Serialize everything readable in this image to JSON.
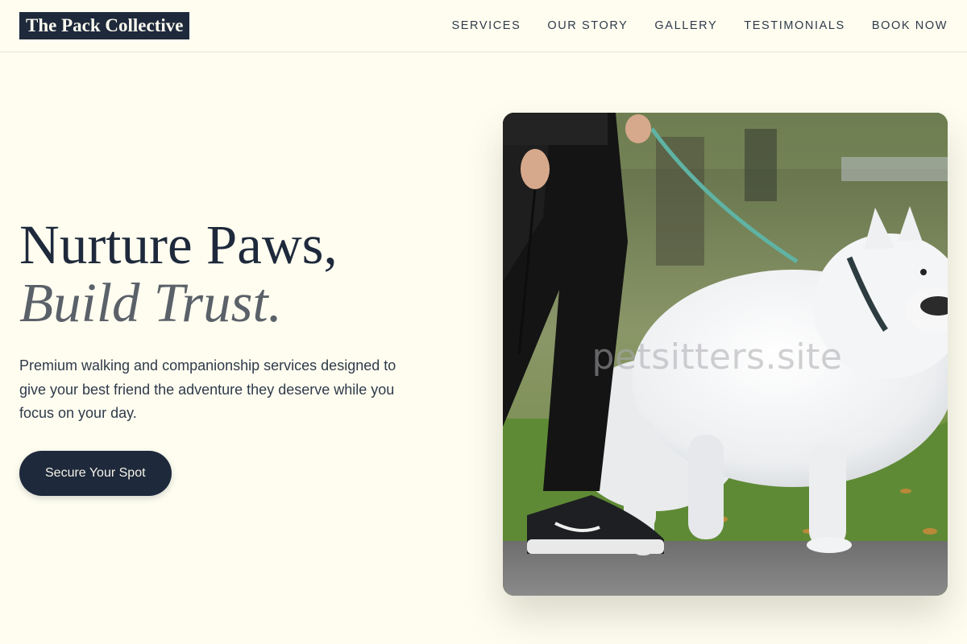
{
  "brand": {
    "name": "The Pack Collective"
  },
  "nav": {
    "items": [
      {
        "label": "SERVICES"
      },
      {
        "label": "OUR STORY"
      },
      {
        "label": "GALLERY"
      },
      {
        "label": "TESTIMONIALS"
      },
      {
        "label": "BOOK NOW"
      }
    ]
  },
  "hero": {
    "headline_line1": "Nurture Paws,",
    "headline_line2": "Build Trust.",
    "lead": "Premium walking and companionship services designed to give your best friend the adventure they deserve while you focus on your day.",
    "cta_label": "Secure Your Spot",
    "photo": {
      "watermark": "petsitters.site"
    }
  },
  "colors": {
    "background": "#fefdf0",
    "navy": "#1e293b",
    "muted_gray": "#5b6169",
    "leash": "#5fb3a3"
  }
}
